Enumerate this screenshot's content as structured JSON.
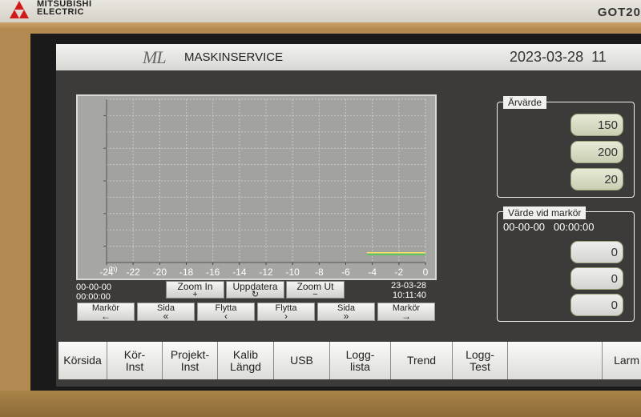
{
  "device": {
    "brand": "MITSUBISHI ELECTRIC",
    "brand_line1": "MITSUBISHI",
    "brand_line2": "ELECTRIC",
    "model": "GOT20"
  },
  "header": {
    "logo": "ML",
    "title": "MASKINSERVICE",
    "date": "2023-03-28",
    "time_partial": "11"
  },
  "chart_data": {
    "type": "line",
    "xlabel": "(h)",
    "x_ticks": [
      "-24",
      "-22",
      "-20",
      "-18",
      "-16",
      "-14",
      "-12",
      "-10",
      "-8",
      "-6",
      "-4",
      "-2",
      "0"
    ],
    "x_range": [
      -24,
      0
    ],
    "grid": true,
    "series": [
      {
        "color": "#ffe066",
        "x": [
          -4.4,
          0
        ],
        "y": [
          6,
          6
        ]
      },
      {
        "color": "#44d04a",
        "x": [
          -4.4,
          0
        ],
        "y": [
          5,
          5
        ]
      }
    ],
    "y_range": [
      0,
      100
    ]
  },
  "chart": {
    "start_date": "00-00-00",
    "start_time": "00:00:00",
    "end_date": "23-03-28",
    "end_time": "10:11:40"
  },
  "zoom_buttons": [
    {
      "label": "Zoom In",
      "symbol": "+"
    },
    {
      "label": "Uppdatera",
      "symbol": "↻"
    },
    {
      "label": "Zoom Ut",
      "symbol": "−"
    }
  ],
  "control_buttons": [
    {
      "label": "Markör",
      "arrow": "←"
    },
    {
      "label": "Sida",
      "arrow": "«"
    },
    {
      "label": "Flytta",
      "arrow": "‹"
    },
    {
      "label": "Flytta",
      "arrow": "›"
    },
    {
      "label": "Sida",
      "arrow": "»"
    },
    {
      "label": "Markör",
      "arrow": "→"
    }
  ],
  "arvarde": {
    "label": "Ärvärde",
    "values": [
      "150",
      "200",
      "20"
    ]
  },
  "marker": {
    "label": "Värde vid markör",
    "date": "00-00-00",
    "time": "00:00:00",
    "values": [
      "0",
      "0",
      "0"
    ]
  },
  "nav": [
    "Körsida",
    "Kör-\nInst",
    "Projekt-\nInst",
    "Kalib\nLängd",
    "USB",
    "Logg-\nlista",
    "Trend",
    "Logg-\nTest",
    "",
    "Larm"
  ],
  "colors": {
    "screen_bg": "#3c3b39",
    "chart_bg": "#a6a6a3",
    "grid": "#c9c9c6",
    "accent_green": "#c9ceb2"
  }
}
